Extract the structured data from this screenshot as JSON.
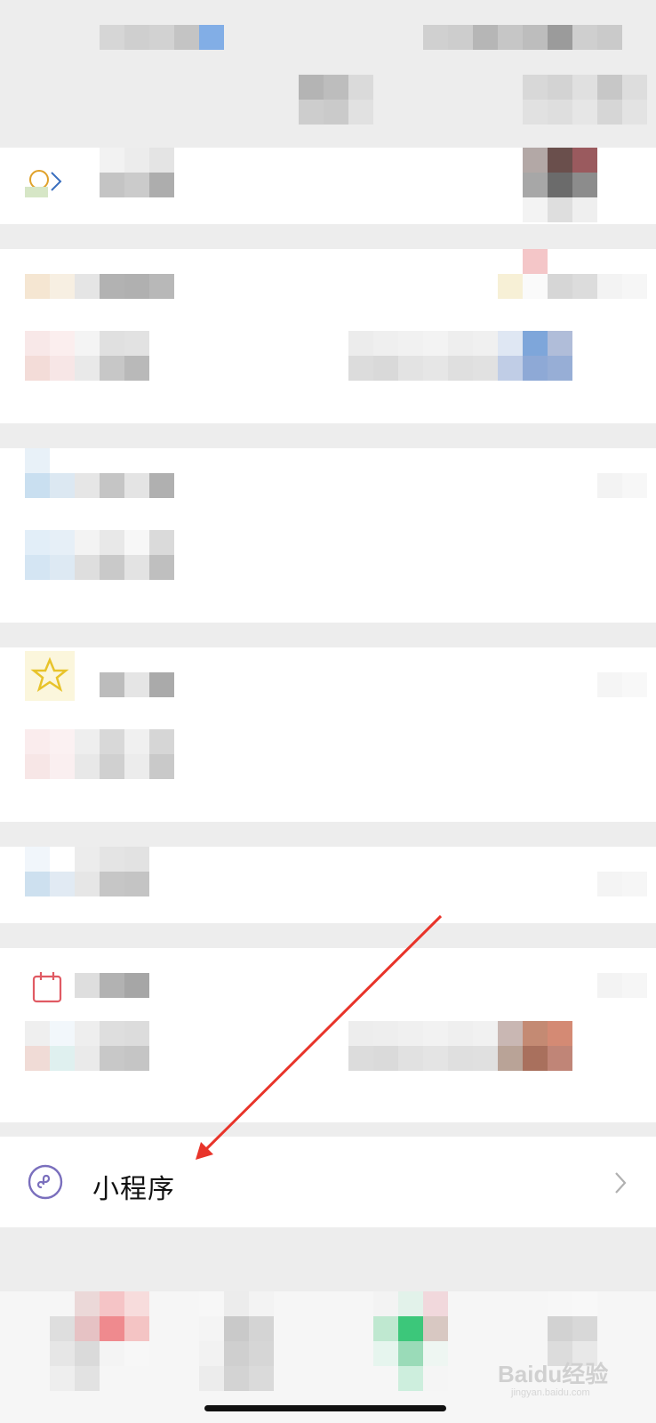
{
  "mini_program": {
    "label": "小程序"
  },
  "watermark": {
    "brand": "Baidu经验",
    "url": "jingyan.baidu.com"
  },
  "colors": {
    "arrow": "#e8342a",
    "mini_icon": "#7a6fbd",
    "calendar_icon": "#e05a63"
  },
  "icons": [
    "mini-program-icon",
    "chevron-right-icon",
    "calendar-icon"
  ]
}
